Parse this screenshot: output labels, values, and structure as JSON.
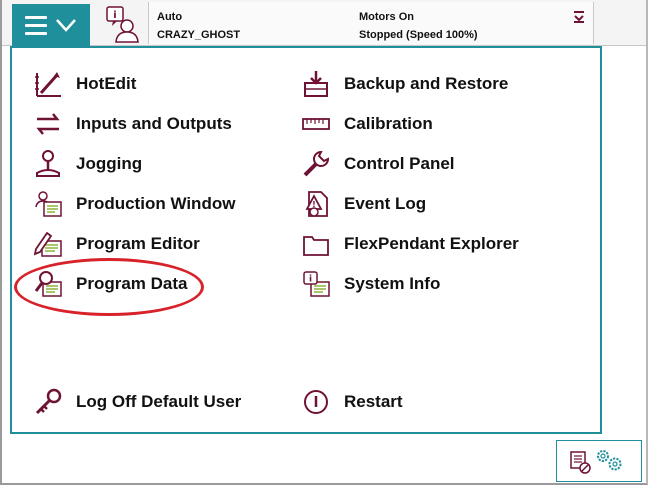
{
  "topbar": {
    "mode": "Auto",
    "controller": "CRAZY_GHOST",
    "motors": "Motors On",
    "state": "Stopped (Speed 100%)"
  },
  "menu": {
    "left": [
      {
        "label": "HotEdit",
        "icon": "hotedit-icon"
      },
      {
        "label": "Inputs and Outputs",
        "icon": "inputs-outputs-icon"
      },
      {
        "label": "Jogging",
        "icon": "joystick-icon"
      },
      {
        "label": "Production Window",
        "icon": "production-window-icon"
      },
      {
        "label": "Program Editor",
        "icon": "program-editor-icon"
      },
      {
        "label": "Program Data",
        "icon": "program-data-icon"
      }
    ],
    "right": [
      {
        "label": "Backup and Restore",
        "icon": "backup-restore-icon"
      },
      {
        "label": "Calibration",
        "icon": "calibration-icon"
      },
      {
        "label": "Control Panel",
        "icon": "wrench-icon"
      },
      {
        "label": "Event Log",
        "icon": "event-log-icon"
      },
      {
        "label": "FlexPendant Explorer",
        "icon": "folder-icon"
      },
      {
        "label": "System Info",
        "icon": "system-info-icon"
      }
    ],
    "logoff": "Log Off Default User",
    "restart": "Restart"
  },
  "colors": {
    "accent": "#1f8f9b",
    "icon": "#6e1236",
    "highlight": "#d8222a"
  }
}
